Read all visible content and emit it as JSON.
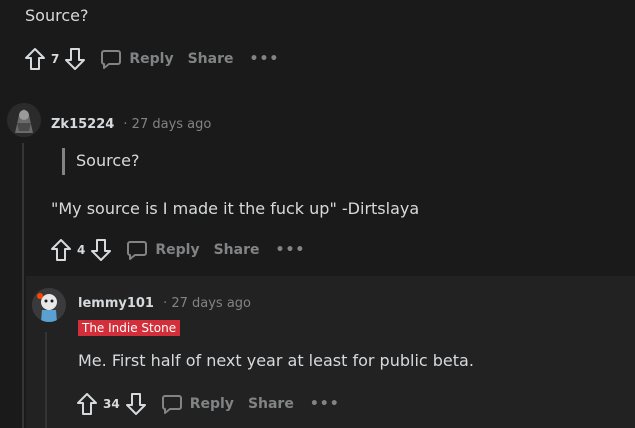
{
  "top_comment": {
    "text": "Source?",
    "votes": "7",
    "reply_label": "Reply",
    "share_label": "Share",
    "more_label": "•••"
  },
  "reply1": {
    "username": "Zk15224",
    "time": "· 27 days ago",
    "quote": "Source?",
    "text": "\"My source is I made it the fuck up\" -Dirtslaya",
    "votes": "4",
    "reply_label": "Reply",
    "share_label": "Share",
    "more_label": "•••"
  },
  "reply2": {
    "username": "lemmy101",
    "time": "· 27 days ago",
    "flair": "The Indie Stone",
    "flair_color": "#d32f3a",
    "text": "Me. First half of next year at least for public beta.",
    "votes": "34",
    "reply_label": "Reply",
    "share_label": "Share",
    "more_label": "•••"
  },
  "colors": {
    "background": "#1a1a1b",
    "highlight_background": "#222223",
    "text": "#d7dadc",
    "muted": "#818384",
    "thread_line": "#343536"
  }
}
